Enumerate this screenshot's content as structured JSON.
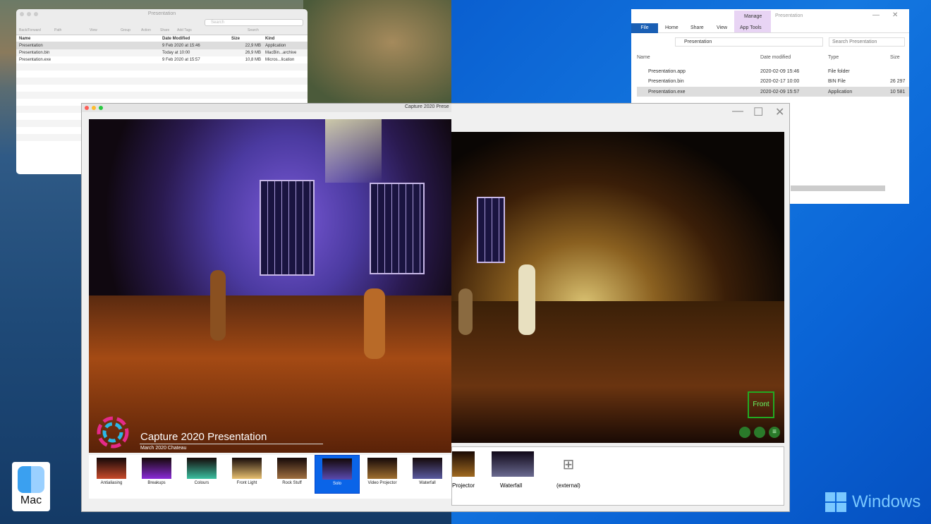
{
  "mac_finder": {
    "title": "Presentation",
    "toolbar": [
      "Back/Forward",
      "Path",
      "View",
      "Group",
      "Action",
      "Share",
      "Add Tags",
      "Search"
    ],
    "search_placeholder": "Search",
    "columns": [
      "Name",
      "Date Modified",
      "Size",
      "Kind"
    ],
    "rows": [
      {
        "name": "Presentation",
        "date": "9 Feb 2020 at 15:46",
        "size": "22,9 MB",
        "kind": "Application"
      },
      {
        "name": "Presentation.bin",
        "date": "Today at 10:00",
        "size": "26,9 MB",
        "kind": "MacBin...archive"
      },
      {
        "name": "Presentation.exe",
        "date": "9 Feb 2020 at 15:57",
        "size": "10,8 MB",
        "kind": "Micros...lication"
      }
    ]
  },
  "win_explorer": {
    "title": "Presentation",
    "context_tab": "Manage",
    "tabs": [
      "File",
      "Home",
      "Share",
      "View",
      "App Tools"
    ],
    "address": "Presentation",
    "search_placeholder": "Search Presentation",
    "columns": [
      "Name",
      "Date modified",
      "Type",
      "Size"
    ],
    "rows": [
      {
        "name": "Presentation.app",
        "date": "2020-02-09 15:46",
        "type": "File folder",
        "size": ""
      },
      {
        "name": "Presentation.bin",
        "date": "2020-02-17 10:00",
        "type": "BIN File",
        "size": "26 297"
      },
      {
        "name": "Presentation.exe",
        "date": "2020-02-09 15:57",
        "type": "Application",
        "size": "10 581"
      }
    ]
  },
  "app": {
    "title": "Capture 2020 Prese",
    "overlay_title": "Capture 2020 Presentation",
    "overlay_subtitle": "March 2020 Chateau",
    "view_cube": "Front",
    "thumbs_mac": [
      "Antialiasing",
      "Breakups",
      "Colours",
      "Front Light",
      "Rock Stuff",
      "Solo",
      "Video Projector",
      "Waterfall"
    ],
    "selected": "Solo",
    "thumbs_win": [
      "Projector",
      "Waterfall",
      "(external)"
    ]
  },
  "badges": {
    "mac": "Mac",
    "windows": "Windows"
  }
}
